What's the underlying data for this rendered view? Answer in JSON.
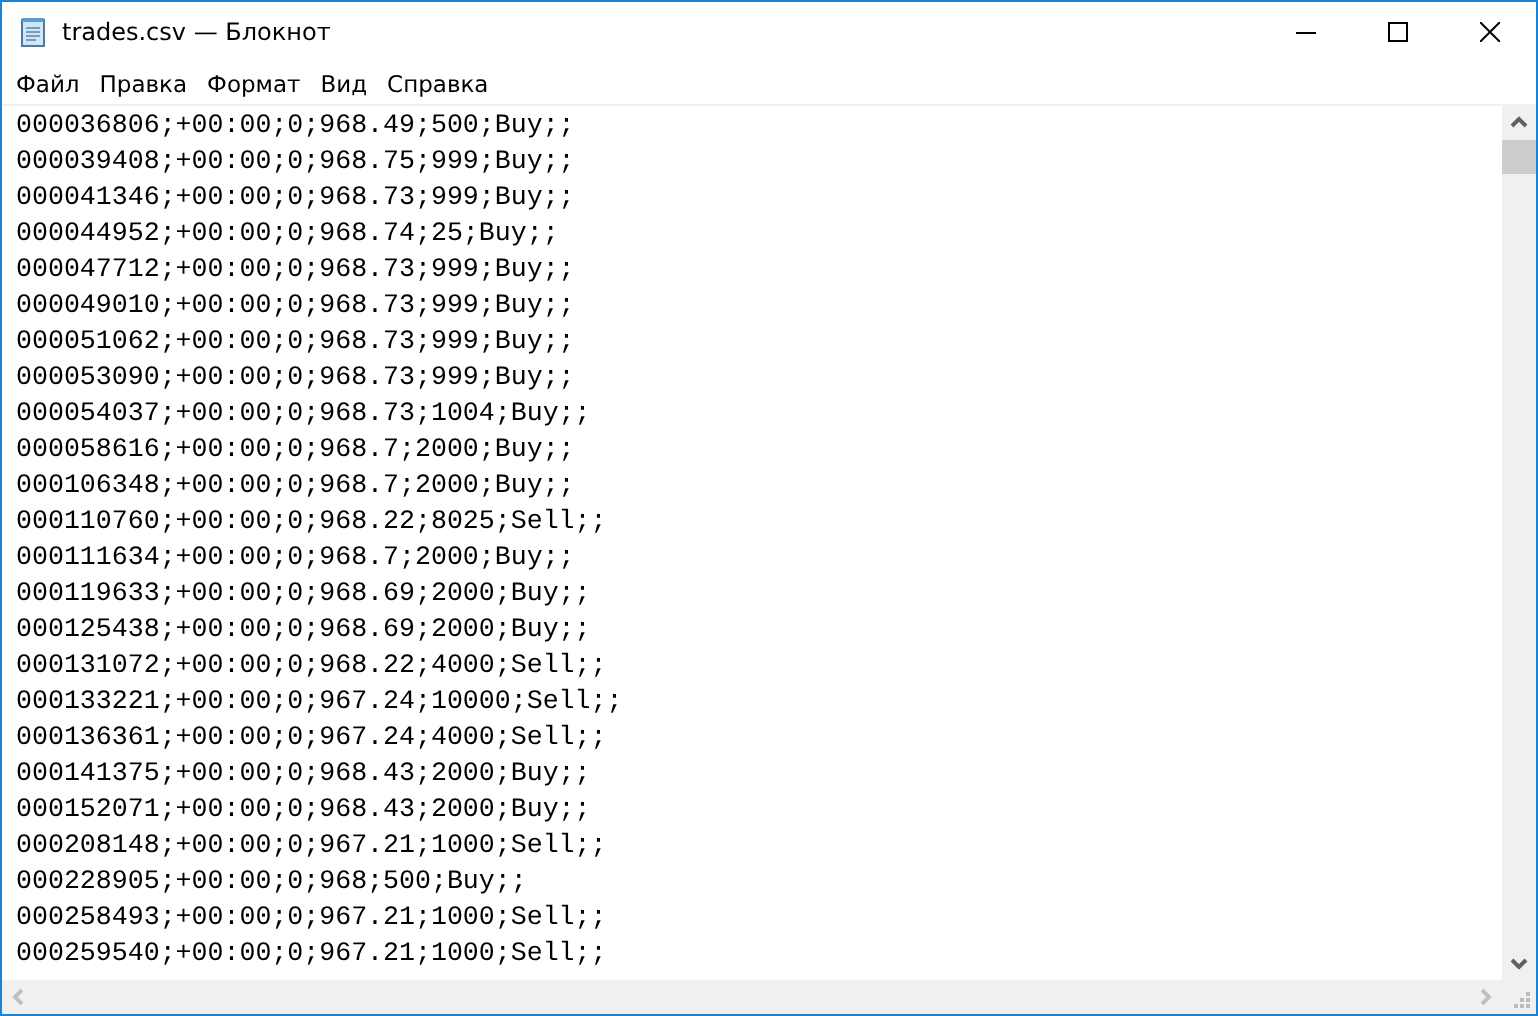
{
  "window": {
    "title": "trades.csv — Блокнот"
  },
  "menu": [
    "Файл",
    "Правка",
    "Формат",
    "Вид",
    "Справка"
  ],
  "lines": [
    "000036806;+00:00;0;968.49;500;Buy;;",
    "000039408;+00:00;0;968.75;999;Buy;;",
    "000041346;+00:00;0;968.73;999;Buy;;",
    "000044952;+00:00;0;968.74;25;Buy;;",
    "000047712;+00:00;0;968.73;999;Buy;;",
    "000049010;+00:00;0;968.73;999;Buy;;",
    "000051062;+00:00;0;968.73;999;Buy;;",
    "000053090;+00:00;0;968.73;999;Buy;;",
    "000054037;+00:00;0;968.73;1004;Buy;;",
    "000058616;+00:00;0;968.7;2000;Buy;;",
    "000106348;+00:00;0;968.7;2000;Buy;;",
    "000110760;+00:00;0;968.22;8025;Sell;;",
    "000111634;+00:00;0;968.7;2000;Buy;;",
    "000119633;+00:00;0;968.69;2000;Buy;;",
    "000125438;+00:00;0;968.69;2000;Buy;;",
    "000131072;+00:00;0;968.22;4000;Sell;;",
    "000133221;+00:00;0;967.24;10000;Sell;;",
    "000136361;+00:00;0;967.24;4000;Sell;;",
    "000141375;+00:00;0;968.43;2000;Buy;;",
    "000152071;+00:00;0;968.43;2000;Buy;;",
    "000208148;+00:00;0;967.21;1000;Sell;;",
    "000228905;+00:00;0;968;500;Buy;;",
    "000258493;+00:00;0;967.21;1000;Sell;;",
    "000259540;+00:00;0;967.21;1000;Sell;;"
  ]
}
